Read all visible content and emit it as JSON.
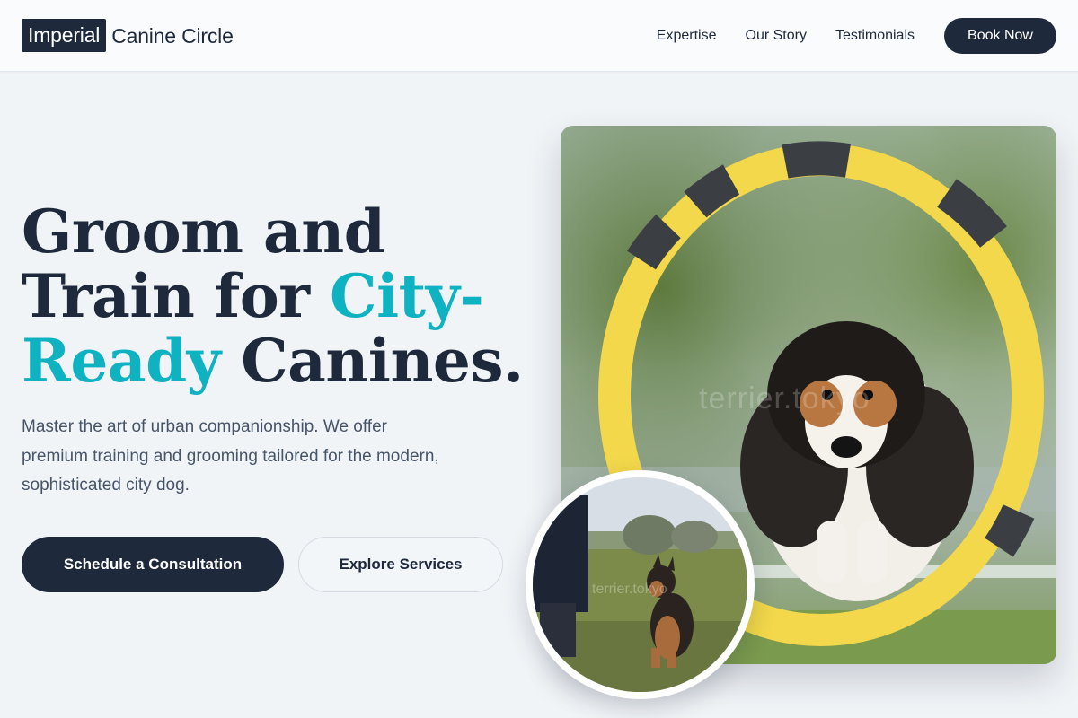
{
  "brand": {
    "mark": "Imperial",
    "name": "Canine Circle"
  },
  "nav": {
    "links": [
      "Expertise",
      "Our Story",
      "Testimonials"
    ],
    "cta": "Book Now"
  },
  "hero": {
    "headline": {
      "line1": "Groom and",
      "line2_plain": "Train for ",
      "line2_accent": "City-",
      "line3_accent": "Ready",
      "line3_plain": " Canines."
    },
    "lede": "Master the art of urban companionship. We offer premium training and grooming tailored for the modern, sophisticated city dog.",
    "primary_button": "Schedule a Consultation",
    "secondary_button": "Explore Services",
    "main_image_watermark": "terrier.tokyo",
    "inset_image_watermark": "terrier.tokyo"
  },
  "colors": {
    "navy": "#1e293b",
    "accent_teal": "#0fb2c0",
    "body_text": "#475569",
    "page_bg": "#f1f4f7"
  }
}
